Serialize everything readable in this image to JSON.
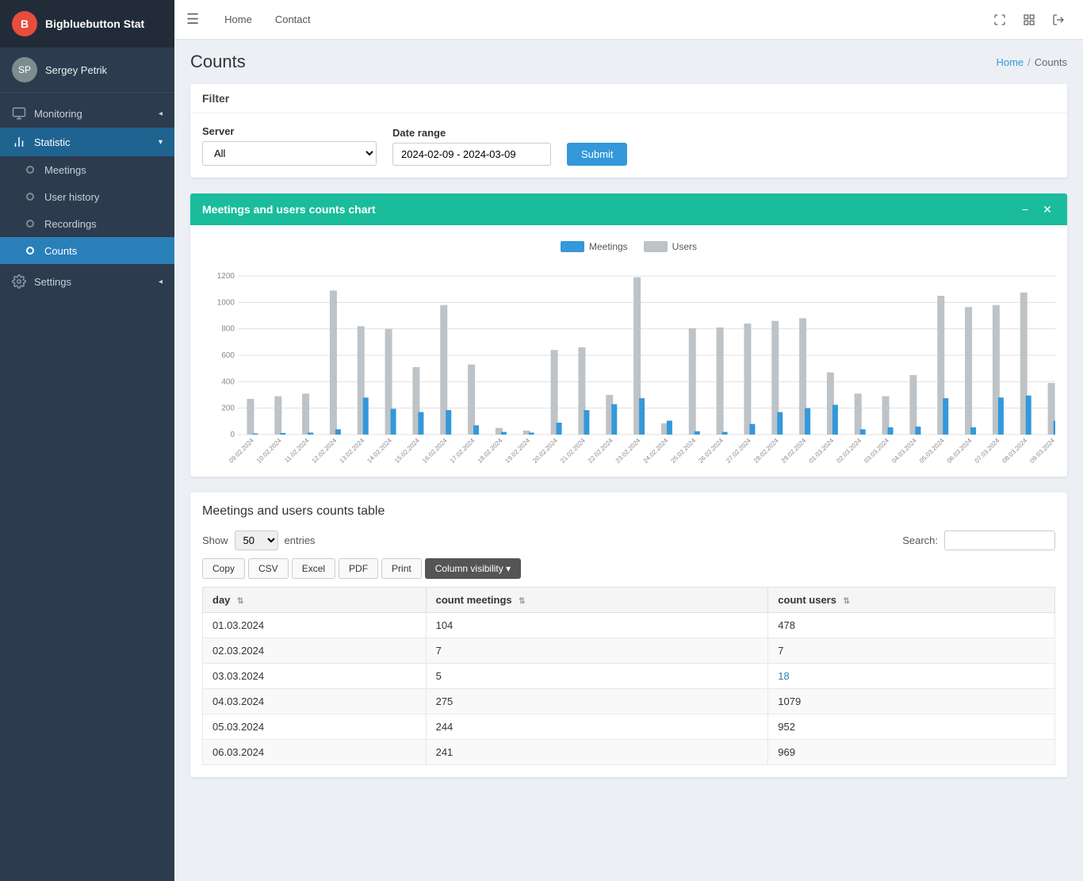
{
  "brand": {
    "icon_text": "B",
    "app_name": "Bigbluebutton Stat"
  },
  "user": {
    "name": "Sergey Petrik",
    "avatar_text": "SP"
  },
  "sidebar": {
    "nav_sections": [
      {
        "id": "monitoring",
        "label": "Monitoring",
        "icon": "monitor",
        "has_arrow": true,
        "active": false
      },
      {
        "id": "statistic",
        "label": "Statistic",
        "icon": "chart",
        "has_arrow": true,
        "active": true
      }
    ],
    "sub_items": [
      {
        "id": "meetings",
        "label": "Meetings",
        "active": false
      },
      {
        "id": "user-history",
        "label": "User history",
        "active": false
      },
      {
        "id": "recordings",
        "label": "Recordings",
        "active": false
      },
      {
        "id": "counts",
        "label": "Counts",
        "active": true
      }
    ],
    "settings": {
      "label": "Settings",
      "has_arrow": true
    }
  },
  "topbar": {
    "home_link": "Home",
    "contact_link": "Contact"
  },
  "breadcrumb": {
    "home": "Home",
    "current": "Counts"
  },
  "page_title": "Counts",
  "filter": {
    "title": "Filter",
    "server_label": "Server",
    "server_value": "All",
    "server_options": [
      "All"
    ],
    "date_range_label": "Date range",
    "date_range_value": "2024-02-09 - 2024-03-09",
    "submit_label": "Submit"
  },
  "chart": {
    "title": "Meetings and users counts chart",
    "legend": [
      {
        "id": "meetings",
        "label": "Meetings",
        "color": "#3498db"
      },
      {
        "id": "users",
        "label": "Users",
        "color": "#bdc3c7"
      }
    ],
    "y_labels": [
      "1200",
      "1000",
      "800",
      "600",
      "400",
      "200",
      "0"
    ],
    "bars": [
      {
        "date": "09.02.2024",
        "meetings": 8,
        "users": 270
      },
      {
        "date": "10.02.2024",
        "meetings": 12,
        "users": 290
      },
      {
        "date": "11.02.2024",
        "meetings": 15,
        "users": 310
      },
      {
        "date": "12.02.2024",
        "meetings": 40,
        "users": 1090
      },
      {
        "date": "13.02.2024",
        "meetings": 280,
        "users": 820
      },
      {
        "date": "14.02.2024",
        "meetings": 195,
        "users": 800
      },
      {
        "date": "15.02.2024",
        "meetings": 170,
        "users": 510
      },
      {
        "date": "16.02.2024",
        "meetings": 185,
        "users": 980
      },
      {
        "date": "17.02.2024",
        "meetings": 70,
        "users": 530
      },
      {
        "date": "18.02.2024",
        "meetings": 20,
        "users": 50
      },
      {
        "date": "19.02.2024",
        "meetings": 15,
        "users": 30
      },
      {
        "date": "20.02.2024",
        "meetings": 90,
        "users": 640
      },
      {
        "date": "21.02.2024",
        "meetings": 185,
        "users": 660
      },
      {
        "date": "22.02.2024",
        "meetings": 230,
        "users": 300
      },
      {
        "date": "23.02.2024",
        "meetings": 275,
        "users": 1190
      },
      {
        "date": "24.02.2024",
        "meetings": 105,
        "users": 85
      },
      {
        "date": "25.02.2024",
        "meetings": 25,
        "users": 805
      },
      {
        "date": "26.02.2024",
        "meetings": 20,
        "users": 810
      },
      {
        "date": "27.02.2024",
        "meetings": 80,
        "users": 840
      },
      {
        "date": "28.02.2024",
        "meetings": 170,
        "users": 860
      },
      {
        "date": "29.02.2024",
        "meetings": 200,
        "users": 880
      },
      {
        "date": "01.03.2024",
        "meetings": 225,
        "users": 470
      },
      {
        "date": "02.03.2024",
        "meetings": 40,
        "users": 310
      },
      {
        "date": "03.03.2024",
        "meetings": 55,
        "users": 290
      },
      {
        "date": "04.03.2024",
        "meetings": 60,
        "users": 450
      },
      {
        "date": "05.03.2024",
        "meetings": 275,
        "users": 1050
      },
      {
        "date": "06.03.2024",
        "meetings": 55,
        "users": 965
      },
      {
        "date": "07.03.2024",
        "meetings": 280,
        "users": 980
      },
      {
        "date": "08.03.2024",
        "meetings": 295,
        "users": 1075
      },
      {
        "date": "09.03.2024",
        "meetings": 105,
        "users": 390
      }
    ]
  },
  "table": {
    "title": "Meetings and users counts table",
    "show_label": "Show",
    "entries_value": "50",
    "entries_label": "entries",
    "search_label": "Search:",
    "search_placeholder": "",
    "buttons": [
      {
        "id": "copy",
        "label": "Copy"
      },
      {
        "id": "csv",
        "label": "CSV"
      },
      {
        "id": "excel",
        "label": "Excel"
      },
      {
        "id": "pdf",
        "label": "PDF"
      },
      {
        "id": "print",
        "label": "Print"
      },
      {
        "id": "column-visibility",
        "label": "Column visibility ▾"
      }
    ],
    "columns": [
      {
        "id": "day",
        "label": "day"
      },
      {
        "id": "count_meetings",
        "label": "count meetings"
      },
      {
        "id": "count_users",
        "label": "count users"
      }
    ],
    "rows": [
      {
        "day": "01.03.2024",
        "count_meetings": "104",
        "count_users": "478"
      },
      {
        "day": "02.03.2024",
        "count_meetings": "7",
        "count_users": "7"
      },
      {
        "day": "03.03.2024",
        "count_meetings": "5",
        "count_users": "18",
        "highlight": true
      },
      {
        "day": "04.03.2024",
        "count_meetings": "275",
        "count_users": "1079"
      },
      {
        "day": "05.03.2024",
        "count_meetings": "244",
        "count_users": "952"
      },
      {
        "day": "06.03.2024",
        "count_meetings": "241",
        "count_users": "969"
      }
    ]
  }
}
